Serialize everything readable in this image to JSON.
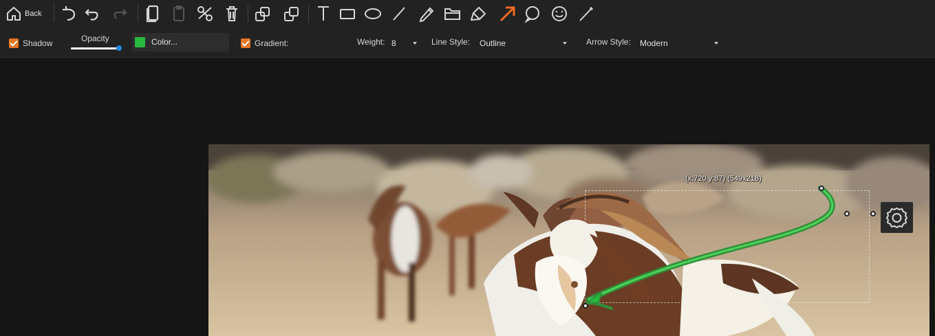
{
  "toolbar": {
    "back_label": "Back",
    "tools": [
      {
        "name": "undo-all-icon"
      },
      {
        "name": "undo-icon"
      },
      {
        "name": "redo-icon"
      },
      {
        "name": "copy-icon"
      },
      {
        "name": "paste-icon"
      },
      {
        "name": "cut-icon"
      },
      {
        "name": "delete-icon"
      },
      {
        "name": "bring-forward-icon"
      },
      {
        "name": "send-backward-icon"
      },
      {
        "name": "text-tool-icon"
      },
      {
        "name": "rectangle-tool-icon"
      },
      {
        "name": "ellipse-tool-icon"
      },
      {
        "name": "line-tool-icon"
      },
      {
        "name": "pencil-tool-icon"
      },
      {
        "name": "folder-tool-icon"
      },
      {
        "name": "highlighter-tool-icon"
      },
      {
        "name": "arrow-tool-icon",
        "active": true
      },
      {
        "name": "speech-bubble-tool-icon"
      },
      {
        "name": "emoji-tool-icon"
      },
      {
        "name": "brush-line-tool-icon"
      }
    ]
  },
  "properties": {
    "shadow_label": "Shadow",
    "shadow_checked": true,
    "opacity_label": "Opacity",
    "opacity_value": 1,
    "color_label": "Color...",
    "color_value": "#27b83f",
    "gradient_label": "Gradient:",
    "gradient_checked": true,
    "weight_label": "Weight:",
    "weight_value": "8",
    "line_style_label": "Line Style:",
    "line_style_value": "Outline",
    "arrow_style_label": "Arrow Style:",
    "arrow_style_value": "Modern"
  },
  "canvas": {
    "coordinate_readout": "(x:720 y:87) (549x218)"
  },
  "colors": {
    "accent": "#e87722",
    "arrow_stroke": "#27b83f",
    "toolbar_background": "#222222",
    "canvas_background": "#151515"
  },
  "icons": {
    "home_back": "home-back-icon",
    "settings": "gear-icon"
  }
}
